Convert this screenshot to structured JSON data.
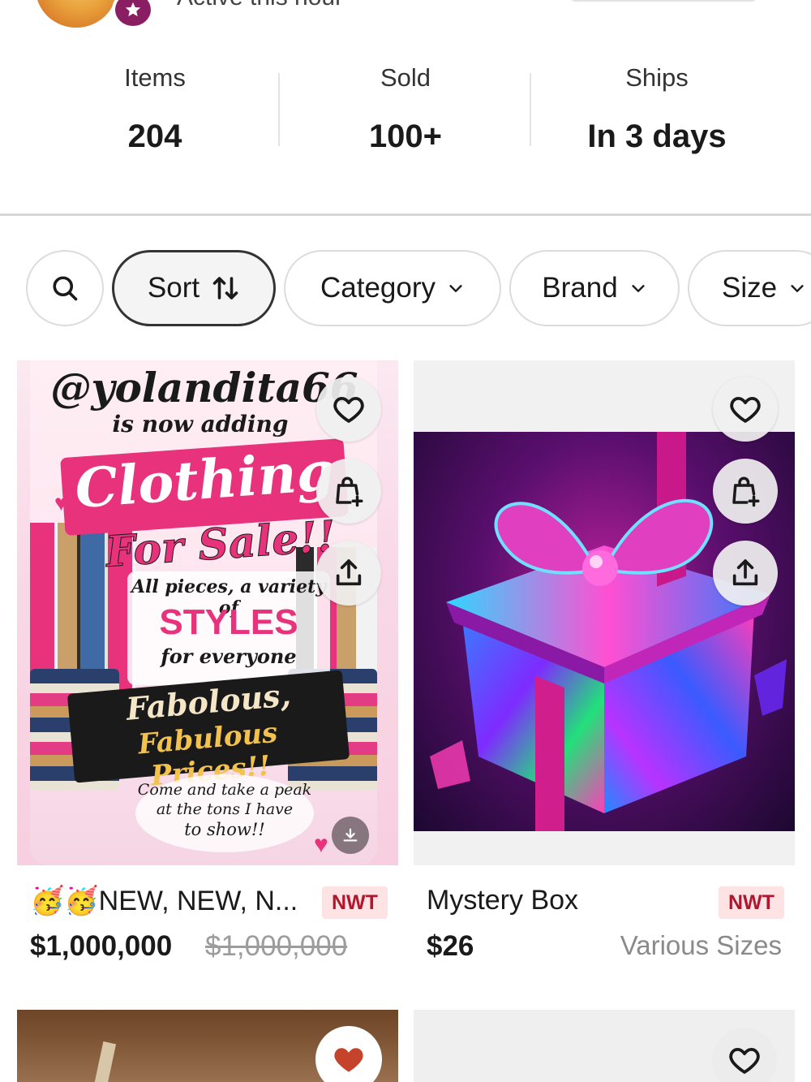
{
  "header": {
    "active_text": "Active this hour"
  },
  "stats": [
    {
      "label": "Items",
      "value": "204"
    },
    {
      "label": "Sold",
      "value": "100+"
    },
    {
      "label": "Ships",
      "value": "In 3 days"
    }
  ],
  "filters": {
    "search_icon": "search-icon",
    "sort_label": "Sort",
    "category_label": "Category",
    "brand_label": "Brand",
    "size_label": "Size"
  },
  "listings": [
    {
      "title": "🥳🥳NEW, NEW, N...",
      "badge": "NWT",
      "price": "$1,000,000",
      "original_price": "$1,000,000",
      "image_text": {
        "handle": "@yolandita66",
        "line1": "is now adding",
        "line2": "Clothing",
        "line3": "For Sale!!",
        "line4": "All pieces, a variety of",
        "line5": "STYLES",
        "line6": "for everyone",
        "line7": "Fabolous,",
        "line8": "Fabulous Prices!!",
        "line9": "Come and take a peak",
        "line10": "at the tons I have",
        "line11": "to show!!"
      }
    },
    {
      "title": "Mystery Box",
      "badge": "NWT",
      "price": "$26",
      "size": "Various Sizes"
    }
  ],
  "colors": {
    "badge_bg": "#fde3e3",
    "badge_text": "#b1162e",
    "liked_heart": "#c5432b",
    "avatar_badge": "#8a1e63"
  }
}
